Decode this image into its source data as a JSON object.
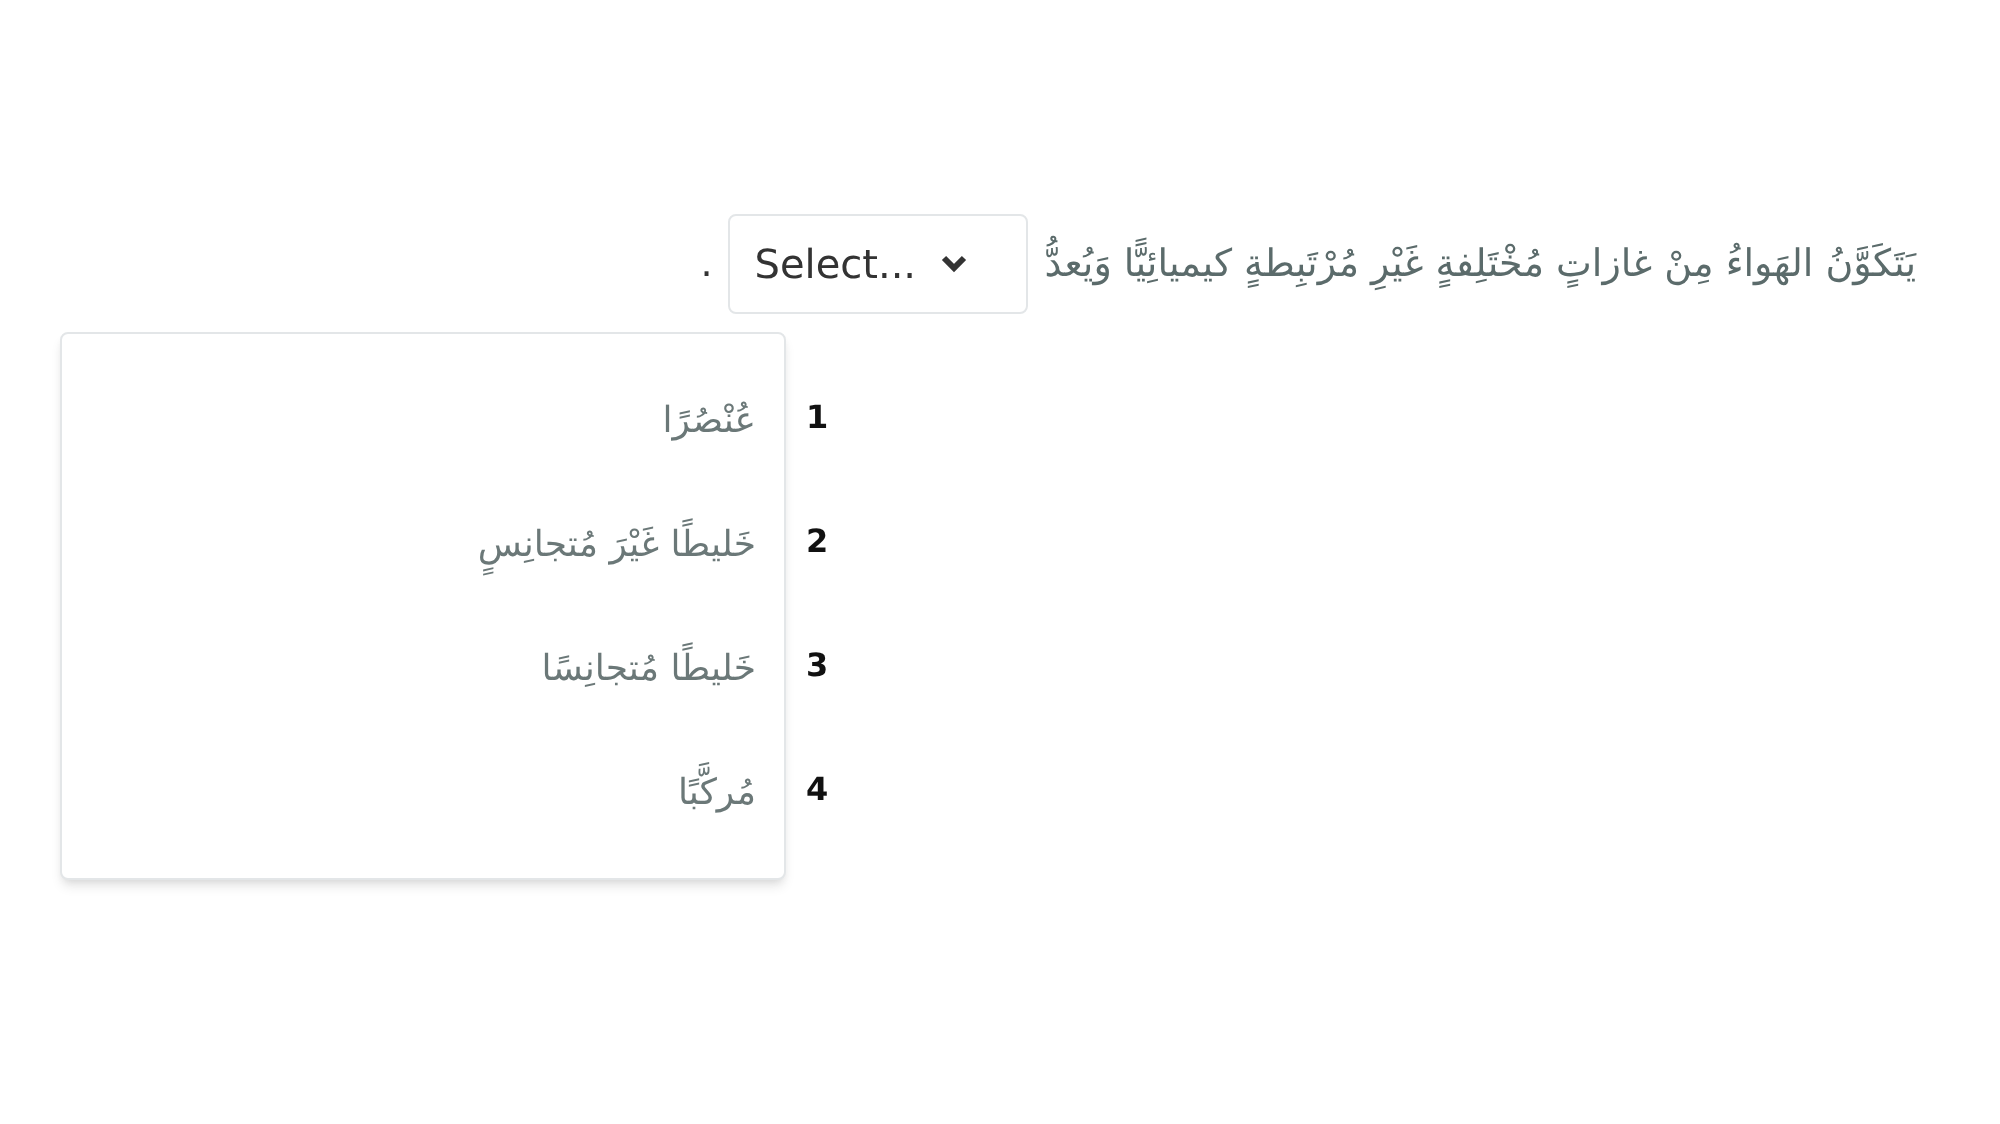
{
  "question": {
    "text": "يَتَكَوَّنُ الهَواءُ مِنْ غازاتٍ مُخْتَلِفةٍ غَيْرِ مُرْتَبِطةٍ كيميائِيًّا وَيُعدُّ",
    "select": {
      "placeholder": "Select...",
      "expanded": true
    },
    "end": "."
  },
  "options": [
    {
      "number": "1",
      "text": "عُنْصُرًا"
    },
    {
      "number": "2",
      "text": "خَليطًا غَيْرَ مُتجانِسٍ"
    },
    {
      "number": "3",
      "text": "خَليطًا مُتجانِسًا"
    },
    {
      "number": "4",
      "text": "مُركَّبًا"
    }
  ]
}
